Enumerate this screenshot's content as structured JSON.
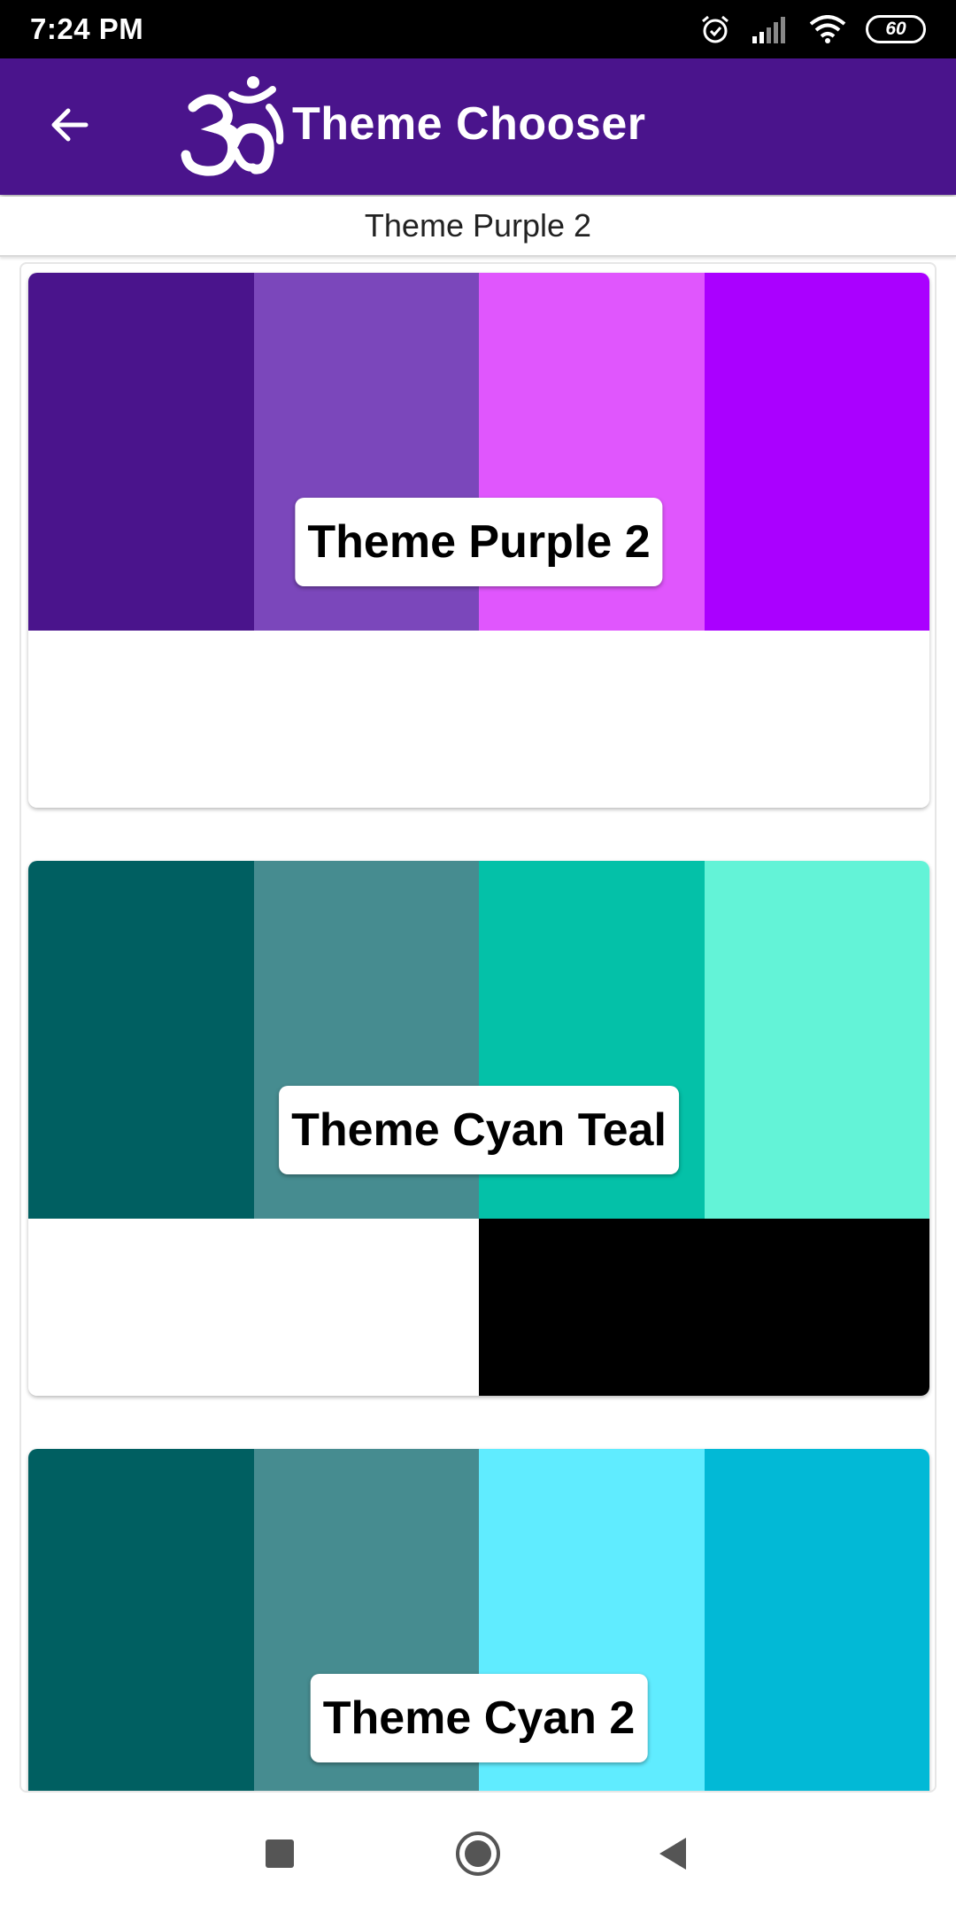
{
  "status_bar": {
    "time": "7:24 PM",
    "battery": "60",
    "icons": [
      "alarm-icon",
      "signal-icon",
      "wifi-icon",
      "battery-icon"
    ]
  },
  "app_bar": {
    "title": "Theme Chooser",
    "back_icon": "arrow-back-icon",
    "logo_icon": "om-symbol-icon",
    "background": "#4a148c"
  },
  "subtitle": "Theme Purple 2",
  "themes": [
    {
      "name": "Theme Purple 2",
      "swatches": [
        "#4a148c",
        "#7b47bb",
        "#e056fd",
        "#aa00ff"
      ],
      "bottom": [
        "#ffffff",
        "#ffffff"
      ]
    },
    {
      "name": "Theme Cyan Teal",
      "swatches": [
        "#005f61",
        "#468c90",
        "#04c1a8",
        "#63f3d7"
      ],
      "bottom": [
        "#ffffff",
        "#000000"
      ]
    },
    {
      "name": "Theme Cyan 2",
      "swatches": [
        "#005f61",
        "#468c90",
        "#60ecff",
        "#02b9d6"
      ],
      "bottom": [
        "#ffffff",
        "#ffffff"
      ]
    }
  ],
  "nav_bar": {
    "buttons": [
      "recents-square-icon",
      "home-circle-icon",
      "back-triangle-icon"
    ]
  }
}
